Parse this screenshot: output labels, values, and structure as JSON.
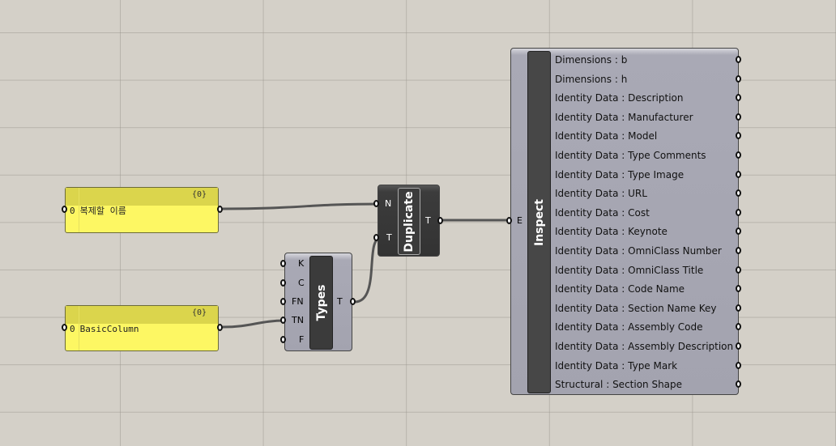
{
  "panels": [
    {
      "header": "{0}",
      "index": "0",
      "value": "복제할 이름"
    },
    {
      "header": "{0}",
      "index": "0",
      "value": "BasicColumn"
    }
  ],
  "types": {
    "title": "Types",
    "inputs": [
      "K",
      "C",
      "FN",
      "TN",
      "F"
    ],
    "output": "T"
  },
  "duplicate": {
    "title": "Duplicate",
    "inputs": [
      "N",
      "T"
    ],
    "output": "T"
  },
  "inspect": {
    "title": "Inspect",
    "input": "E",
    "outputs": [
      "Dimensions : b",
      "Dimensions : h",
      "Identity Data : Description",
      "Identity Data : Manufacturer",
      "Identity Data : Model",
      "Identity Data : Type Comments",
      "Identity Data : Type Image",
      "Identity Data : URL",
      "Identity Data : Cost",
      "Identity Data : Keynote",
      "Identity Data : OmniClass Number",
      "Identity Data : OmniClass Title",
      "Identity Data : Code Name",
      "Identity Data : Section Name Key",
      "Identity Data : Assembly Code",
      "Identity Data : Assembly Description",
      "Identity Data : Type Mark",
      "Structural : Section Shape"
    ]
  }
}
